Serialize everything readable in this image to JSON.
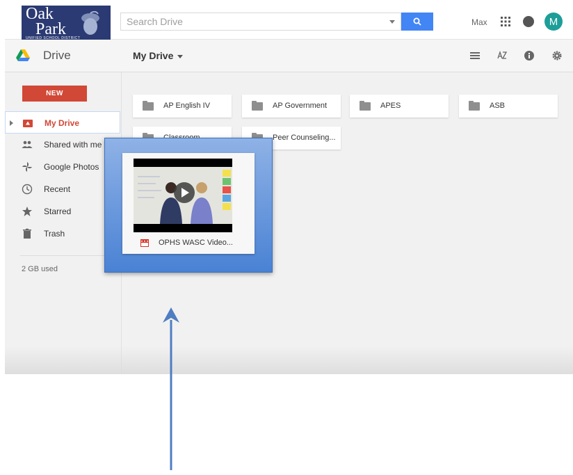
{
  "topbar": {
    "logo": {
      "line1": "Oak",
      "line2": "Park",
      "subtitle": "UNIFIED SCHOOL DISTRICT"
    },
    "search": {
      "placeholder": "Search Drive"
    },
    "user_name": "Max",
    "avatar_initial": "M"
  },
  "subbar": {
    "app_title": "Drive",
    "breadcrumb": "My Drive",
    "icons": [
      "list-view-icon",
      "sort-az-icon",
      "info-icon",
      "settings-icon"
    ]
  },
  "sidebar": {
    "new_label": "NEW",
    "items": [
      {
        "label": "My Drive",
        "icon": "my-drive-icon",
        "active": true
      },
      {
        "label": "Shared with me",
        "icon": "people-icon",
        "active": false
      },
      {
        "label": "Google Photos",
        "icon": "photos-pinwheel-icon",
        "active": false
      },
      {
        "label": "Recent",
        "icon": "clock-icon",
        "active": false
      },
      {
        "label": "Starred",
        "icon": "star-icon",
        "active": false
      },
      {
        "label": "Trash",
        "icon": "trash-icon",
        "active": false
      }
    ],
    "storage": "2 GB used"
  },
  "folders": [
    {
      "name": "AP English IV"
    },
    {
      "name": "AP Government"
    },
    {
      "name": "APES"
    },
    {
      "name": "ASB"
    },
    {
      "name": "Classroom"
    },
    {
      "name": "Peer Counseling..."
    }
  ],
  "highlighted_file": {
    "name": "OPHS WASC Video...",
    "icon": "video-file-icon"
  },
  "colors": {
    "accent_red": "#d14836",
    "search_blue": "#4285f4",
    "avatar_teal": "#1e9e98",
    "highlight_blue": "#4a82d4",
    "logo_navy": "#2b3a73"
  }
}
